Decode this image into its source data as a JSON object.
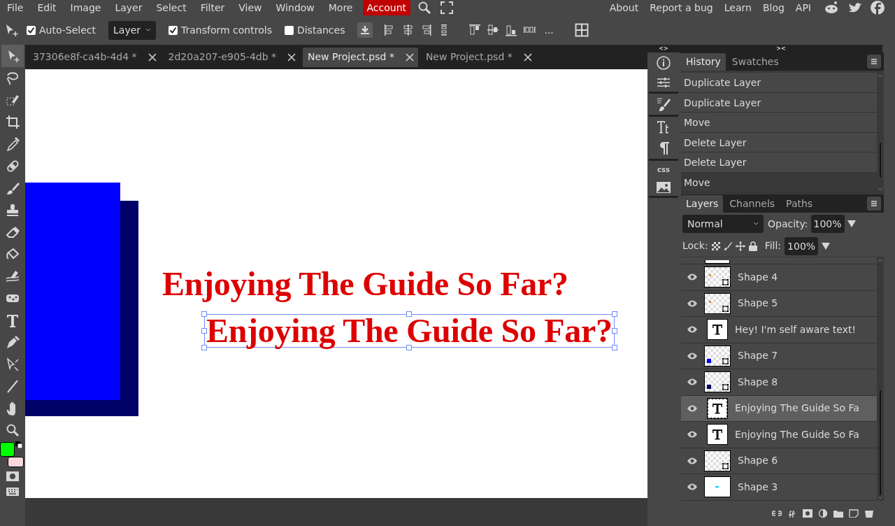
{
  "menu": [
    {
      "label": "File",
      "selected": false
    },
    {
      "label": "Edit",
      "selected": false
    },
    {
      "label": "Image",
      "selected": false
    },
    {
      "label": "Layer",
      "selected": false
    },
    {
      "label": "Select",
      "selected": false
    },
    {
      "label": "Filter",
      "selected": false
    },
    {
      "label": "View",
      "selected": false
    },
    {
      "label": "Window",
      "selected": false
    },
    {
      "label": "More",
      "selected": false
    },
    {
      "label": "Account",
      "selected": true
    }
  ],
  "links": [
    "About",
    "Report a bug",
    "Learn",
    "Blog",
    "API"
  ],
  "options": {
    "auto_select": {
      "label": "Auto-Select",
      "checked": true
    },
    "mode": "Layer",
    "transform_controls": {
      "label": "Transform controls",
      "checked": true
    },
    "distances": {
      "label": "Distances",
      "checked": false
    },
    "more": "..."
  },
  "tabs": [
    {
      "label": "37306e8f-ca4b-4d4 *",
      "selected": false
    },
    {
      "label": "2d20a207-e905-4db *",
      "selected": false
    },
    {
      "label": "New Project.psd *",
      "selected": true
    },
    {
      "label": "New Project.psd *",
      "selected": false
    }
  ],
  "swatches": [
    {
      "kind": "background",
      "color": "#f6d8d8"
    },
    {
      "kind": "foreground",
      "color": "#00ff00"
    }
  ],
  "canvas_texts": [
    {
      "text": "Enjoying The Guide So Far?",
      "selected": false
    },
    {
      "text": "Enjoying The Guide So Far?",
      "selected": true
    }
  ],
  "side_strip": {
    "expand": "<>",
    "collapse": "><",
    "css": "css"
  },
  "history": {
    "tabs": [
      {
        "label": "History",
        "selected": true
      },
      {
        "label": "Swatches",
        "selected": false
      }
    ],
    "items": [
      {
        "label": "Duplicate Layer",
        "selected": false
      },
      {
        "label": "Duplicate Layer",
        "selected": false
      },
      {
        "label": "Move",
        "selected": false
      },
      {
        "label": "Delete Layer",
        "selected": false
      },
      {
        "label": "Delete Layer",
        "selected": false
      },
      {
        "label": "Move",
        "selected": true
      }
    ]
  },
  "layers": {
    "tabs": [
      {
        "label": "Layers",
        "selected": true
      },
      {
        "label": "Channels",
        "selected": false
      },
      {
        "label": "Paths",
        "selected": false
      }
    ],
    "blend_mode": "Normal",
    "opacity_label": "Opacity:",
    "opacity": "100%",
    "lock_label": "Lock:",
    "fill_label": "Fill:",
    "fill": "100%",
    "items": [
      {
        "name": "Shape 4",
        "kind": "shape",
        "color": "#d99a1a",
        "selected": false
      },
      {
        "name": "Shape 5",
        "kind": "shape",
        "color": "#d99a1a",
        "selected": false
      },
      {
        "name": "Hey! I'm self aware text!",
        "kind": "text",
        "selected": false
      },
      {
        "name": "Shape 7",
        "kind": "shape",
        "color": "#0000ff",
        "selected": false
      },
      {
        "name": "Shape 8",
        "kind": "shape",
        "color": "#000066",
        "selected": false
      },
      {
        "name": "Enjoying The Guide So Fa",
        "kind": "text",
        "selected": true
      },
      {
        "name": "Enjoying The Guide So Fa",
        "kind": "text",
        "selected": false
      },
      {
        "name": "Shape 6",
        "kind": "shape",
        "selected": false
      },
      {
        "name": "Shape 3",
        "kind": "raster",
        "color": "#00c8ff",
        "selected": false
      }
    ]
  }
}
